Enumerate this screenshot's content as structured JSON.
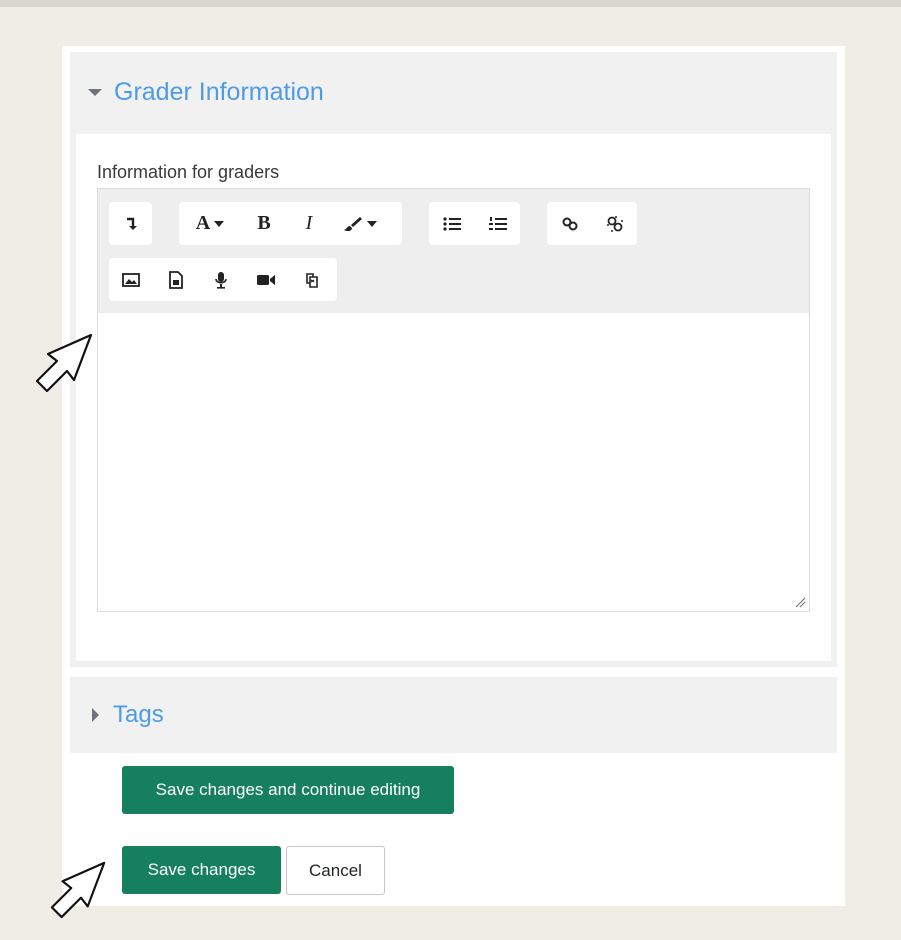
{
  "grader_section": {
    "title": "Grader Information",
    "expanded": true,
    "field_label": "Information for graders"
  },
  "editor_toolbar": {
    "row1": [
      {
        "group": "collapse",
        "buttons": [
          "collapse-toggle-icon"
        ]
      },
      {
        "group": "style",
        "buttons": [
          "font-style-icon",
          "bold-icon",
          "italic-icon",
          "paint-brush-icon"
        ]
      },
      {
        "group": "list",
        "buttons": [
          "unordered-list-icon",
          "ordered-list-icon"
        ]
      },
      {
        "group": "links",
        "buttons": [
          "link-icon",
          "unlink-icon"
        ]
      }
    ],
    "row2": [
      {
        "group": "media",
        "buttons": [
          "image-icon",
          "media-file-icon",
          "microphone-icon",
          "video-camera-icon",
          "manage-files-icon"
        ]
      }
    ],
    "font_glyph": "A",
    "bold_glyph": "B",
    "italic_glyph": "I"
  },
  "tags_section": {
    "title": "Tags",
    "expanded": false
  },
  "actions": {
    "save_continue_label": "Save changes and continue editing",
    "save_label": "Save changes",
    "cancel_label": "Cancel"
  },
  "colors": {
    "background": "#f0ede6",
    "section_bg": "#f1f1f1",
    "link_blue": "#4e9be6",
    "primary_green": "#16805e"
  }
}
